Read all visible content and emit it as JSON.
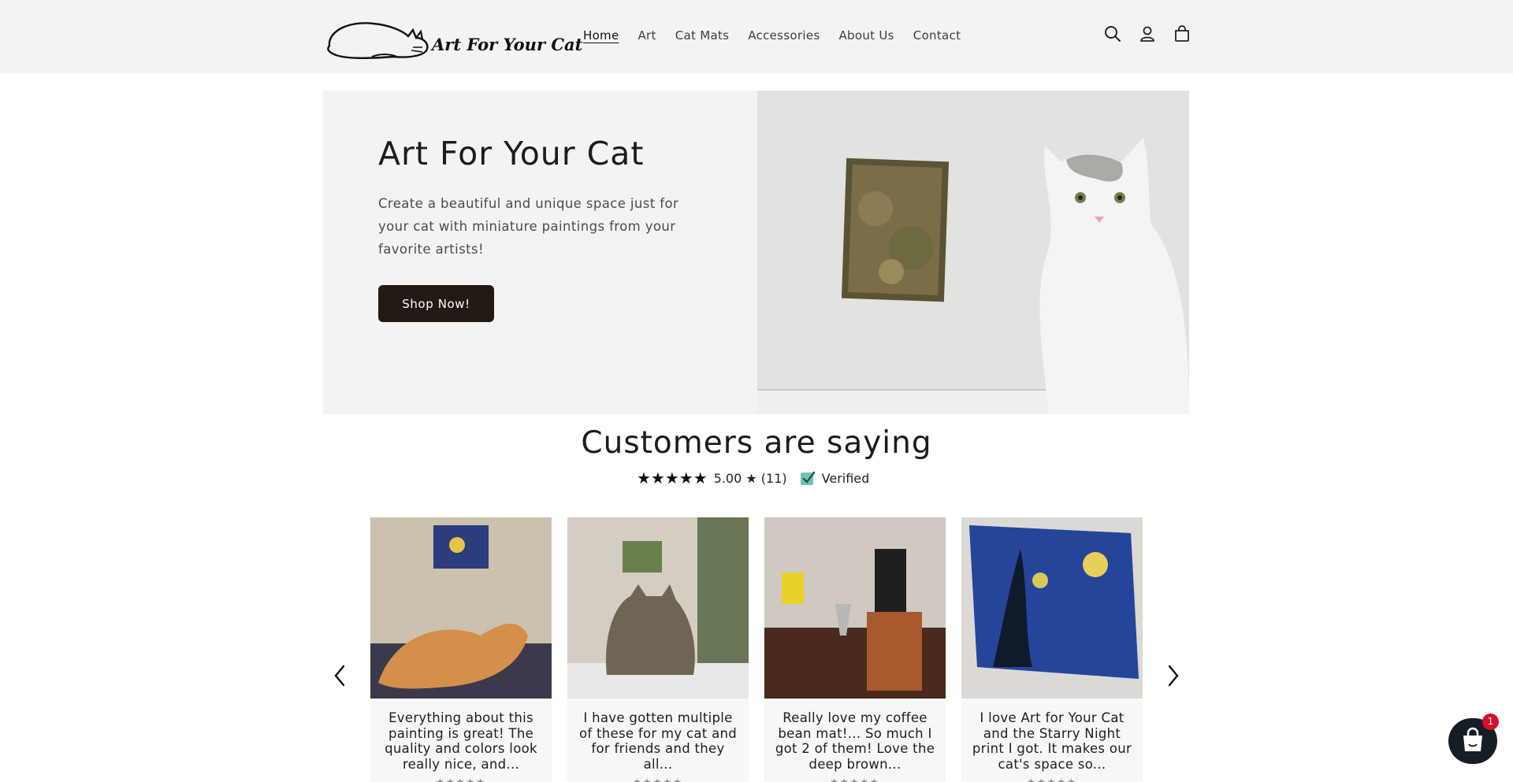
{
  "header": {
    "logo_text": "Art For Your Cat",
    "nav": [
      {
        "label": "Home",
        "active": true
      },
      {
        "label": "Art"
      },
      {
        "label": "Cat Mats"
      },
      {
        "label": "Accessories"
      },
      {
        "label": "About Us"
      },
      {
        "label": "Contact"
      }
    ],
    "icons": [
      "search-icon",
      "account-icon",
      "cart-icon"
    ]
  },
  "hero": {
    "title": "Art For Your Cat",
    "text": "Create a beautiful and unique space just for your cat with miniature paintings from your favorite artists!",
    "button": "Shop Now!"
  },
  "reviews": {
    "title": "Customers are saying",
    "stars": "★★★★★",
    "rating_text": "5.00 ★ (11)",
    "verified": "Verified",
    "cards": [
      {
        "text": "Everything about this painting is great! The quality and colors look really nice, and..."
      },
      {
        "text": "I have gotten multiple of these for my cat and for friends and they all..."
      },
      {
        "text": "Really love my coffee bean mat!... So much I got 2 of them! Love the deep brown..."
      },
      {
        "text": "I love Art for Your Cat and the Starry Night print I got. It makes our cat's space so..."
      }
    ]
  },
  "chat": {
    "badge": "1"
  },
  "colors": {
    "accent": "#231a16",
    "header_bg": "#f3f3f3",
    "badge": "#d51028"
  }
}
